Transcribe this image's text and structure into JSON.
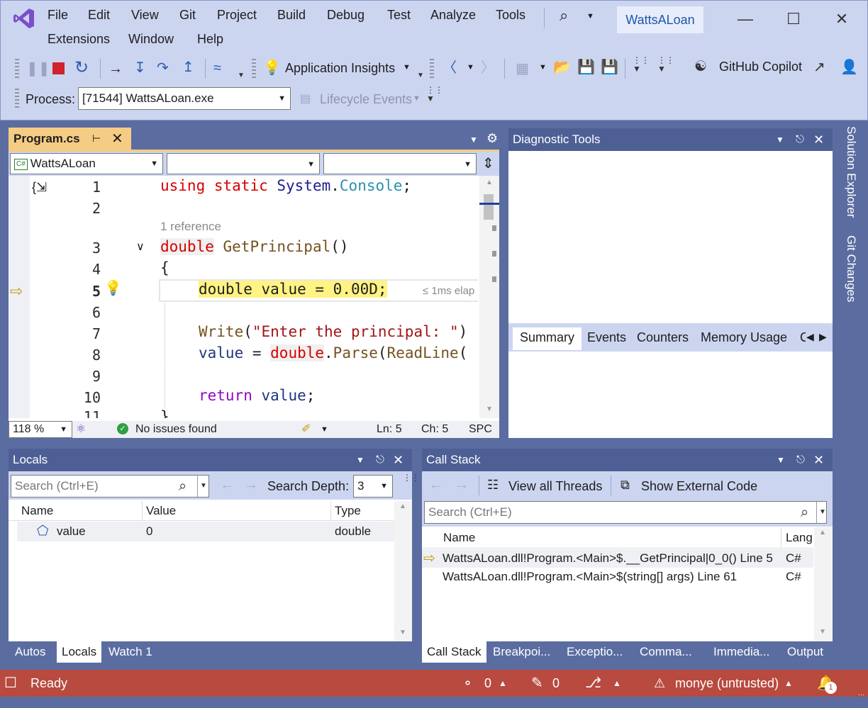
{
  "menu": {
    "row1": [
      "File",
      "Edit",
      "View",
      "Git",
      "Project",
      "Build",
      "Debug",
      "Test",
      "Analyze",
      "Tools"
    ],
    "row2": [
      "Extensions",
      "Window",
      "Help"
    ]
  },
  "solution_name": "WattsALoan",
  "toolbar": {
    "app_insights": "Application Insights",
    "github_copilot": "GitHub Copilot",
    "process_label": "Process:",
    "process_value": "[71544] WattsALoan.exe",
    "lifecycle": "Lifecycle Events"
  },
  "editor": {
    "tab_title": "Program.cs",
    "nav_project": "WattsALoan",
    "nav_project_badge": "C#",
    "ref_lens": "1 reference",
    "elapsed": "≤ 1ms elap",
    "lines": [
      "1",
      "2",
      "3",
      "4",
      "5",
      "6",
      "7",
      "8",
      "9",
      "10",
      "11"
    ],
    "code": {
      "l1_using": "using",
      "l1_static": "static",
      "l1_system": "System",
      "l1_dot": ".",
      "l1_console": "Console",
      "l1_semi": ";",
      "l3_double": "double",
      "l3_method": "GetPrincipal",
      "l3_parens": "()",
      "l4": "{",
      "l5_double": "double",
      "l5_value": "value",
      "l5_rest": " = 0.00D;",
      "l7_write": "Write",
      "l7_open": "(",
      "l7_str": "\"Enter the principal: \"",
      "l7_tail": ")",
      "l8_value": "value",
      "l8_eq": " = ",
      "l8_double": "double",
      "l8_dot": ".",
      "l8_parse": "Parse",
      "l8_open": "(",
      "l8_readline": "ReadLine",
      "l8_tail": "(",
      "l10_return": "return",
      "l10_value": "value",
      "l10_semi": ";",
      "l11": "}"
    },
    "zoom": "118 %",
    "issues": "No issues found",
    "ln": "Ln: 5",
    "ch": "Ch: 5",
    "mode": "SPC"
  },
  "diagnostic": {
    "title": "Diagnostic Tools",
    "tabs": [
      "Summary",
      "Events",
      "Counters",
      "Memory Usage",
      "C"
    ]
  },
  "side_tabs": [
    "Solution Explorer",
    "Git Changes"
  ],
  "locals": {
    "title": "Locals",
    "search_placeholder": "Search (Ctrl+E)",
    "search_depth_label": "Search Depth:",
    "search_depth": "3",
    "columns": [
      "Name",
      "Value",
      "Type"
    ],
    "rows": [
      {
        "name": "value",
        "value": "0",
        "type": "double"
      }
    ],
    "tabs": [
      "Autos",
      "Locals",
      "Watch 1"
    ]
  },
  "callstack": {
    "title": "Call Stack",
    "view_threads": "View all Threads",
    "show_external": "Show External Code",
    "search_placeholder": "Search (Ctrl+E)",
    "columns": [
      "Name",
      "Lang"
    ],
    "rows": [
      {
        "name": "WattsALoan.dll!Program.<Main>$.__GetPrincipal|0_0() Line 5",
        "lang": "C#"
      },
      {
        "name": "WattsALoan.dll!Program.<Main>$(string[] args) Line 61",
        "lang": "C#"
      }
    ],
    "tabs": [
      "Call Stack",
      "Breakpoi...",
      "Exceptio...",
      "Comma...",
      "Immedia...",
      "Output"
    ]
  },
  "status": {
    "ready": "Ready",
    "commits": "0",
    "edits": "0",
    "user": "monye (untrusted)",
    "notifications": "1"
  },
  "colors": {
    "statusbar": "#b84a3f",
    "chrome": "#ccd5f0",
    "panel_header": "#4e5f95",
    "current_line_highlight": "#fff383"
  }
}
